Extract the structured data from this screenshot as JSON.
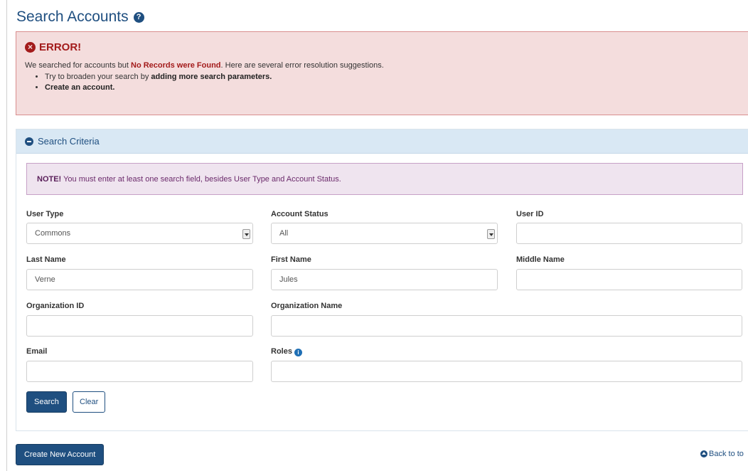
{
  "page": {
    "title": "Search Accounts",
    "help_icon": "question-circle-icon"
  },
  "error": {
    "title": "ERROR!",
    "icon": "x-circle-icon",
    "message_prefix": "We searched for accounts but ",
    "message_highlight": "No Records were Found",
    "message_suffix": ". Here are several error resolution suggestions.",
    "suggestion1_prefix": "Try to broaden your search by ",
    "suggestion1_bold": "adding more search parameters.",
    "suggestion2_bold": "Create an account."
  },
  "search_panel": {
    "header": "Search Criteria",
    "header_icon": "minus-circle-icon",
    "note_label": "NOTE!",
    "note_text": " You must enter at least one search field, besides User Type and Account Status."
  },
  "fields": {
    "user_type": {
      "label": "User Type",
      "value": "Commons"
    },
    "account_status": {
      "label": "Account Status",
      "value": "All"
    },
    "user_id": {
      "label": "User ID",
      "value": ""
    },
    "last_name": {
      "label": "Last Name",
      "value": "Verne"
    },
    "first_name": {
      "label": "First Name",
      "value": "Jules"
    },
    "middle_name": {
      "label": "Middle Name",
      "value": ""
    },
    "organization_id": {
      "label": "Organization ID",
      "value": ""
    },
    "organization_name": {
      "label": "Organization Name",
      "value": ""
    },
    "email": {
      "label": "Email",
      "value": ""
    },
    "roles": {
      "label": "Roles",
      "value": "",
      "info_icon": "info-circle-icon"
    }
  },
  "buttons": {
    "search": "Search",
    "clear": "Clear",
    "create_new_account": "Create New Account"
  },
  "footer": {
    "back_to_top": "Back to to",
    "back_icon": "arrow-up-circle-icon"
  },
  "colors": {
    "primary": "#1f4f80",
    "error_text": "#a31b1b",
    "error_bg": "#f4dddd",
    "note_bg": "#efe4ef",
    "panel_header_bg": "#d9e8f4"
  }
}
